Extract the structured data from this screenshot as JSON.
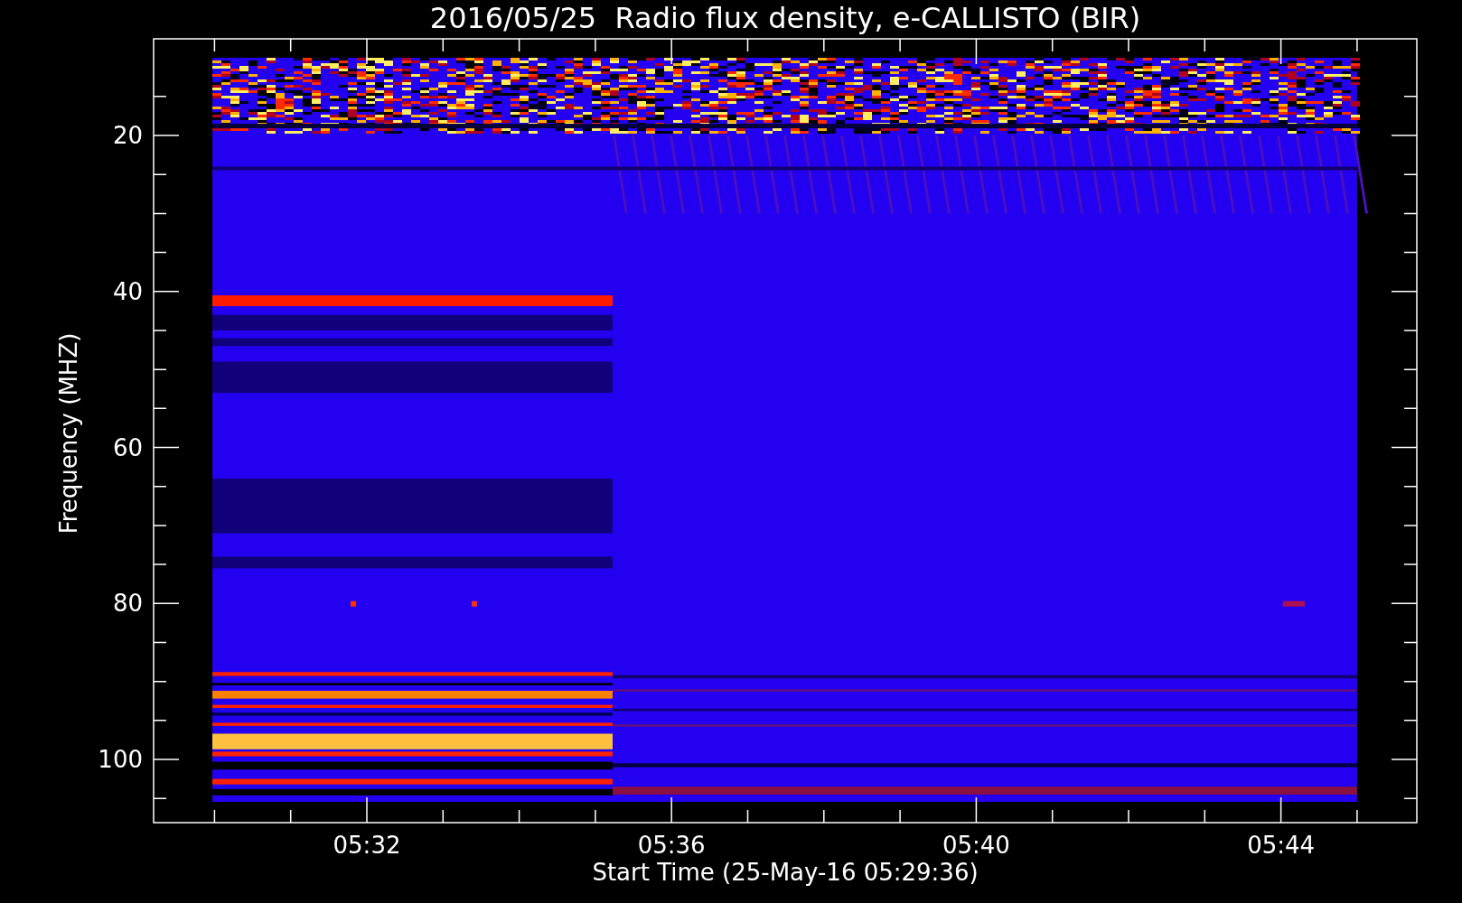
{
  "title": "2016/05/25  Radio flux density, e-CALLISTO (BIR)",
  "y_axis": {
    "label": "Frequency (MHZ)",
    "ticks": [
      "20",
      "40",
      "60",
      "80",
      "100"
    ]
  },
  "x_axis": {
    "label": "Start Time (25-May-16 05:29:36)",
    "ticks": [
      "05:32",
      "05:36",
      "05:40",
      "05:44"
    ]
  }
}
